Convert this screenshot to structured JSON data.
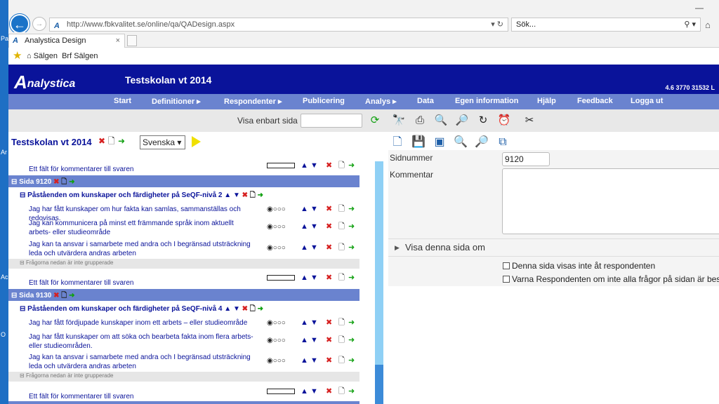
{
  "desktop": {
    "labels": [
      "Pa",
      "Ar",
      "Ac",
      "O"
    ]
  },
  "browser": {
    "url": "http://www.fbkvalitet.se/online/qa/QADesign.aspx",
    "search_placeholder": "Sök...",
    "tab_title": "Analystica Design",
    "favorites": [
      {
        "label": "Sälgen"
      },
      {
        "label": "Brf Sälgen"
      }
    ]
  },
  "app": {
    "logo": "nalystica",
    "logo_initial": "A",
    "title": "Testskolan vt 2014",
    "version": "4.6 3770 31532 L",
    "menu": [
      {
        "label": "Start"
      },
      {
        "label": "Definitioner"
      },
      {
        "label": "Respondenter"
      },
      {
        "label": "Publicering"
      },
      {
        "label": "Analys"
      },
      {
        "label": "Data"
      },
      {
        "label": "Egen information"
      },
      {
        "label": "Hjälp"
      },
      {
        "label": "Feedback"
      },
      {
        "label": "Logga ut"
      }
    ],
    "toolbar": {
      "filter_label": "Visa enbart sida",
      "filter_value": ""
    }
  },
  "survey": {
    "title": "Testskolan vt 2014",
    "language": "Svenska",
    "comment_label": "Ett fält för kommentarer till svaren",
    "ungrouped_label": "Frågorna nedan är inte grupperade",
    "pages": [
      {
        "label": "Sida 9120",
        "group": "Påståenden om kunskaper och färdigheter på SeQF-nivå 2",
        "questions": [
          "Jag har fått kunskaper om hur fakta kan samlas, sammanställas och redovisas.",
          "Jag kan kommunicera på minst ett främmande språk inom aktuellt arbets- eller studieområde",
          "Jag kan ta ansvar i samarbete med andra och I begränsad utsträckning leda och utvärdera andras arbeten"
        ]
      },
      {
        "label": "Sida 9130",
        "group": "Påståenden om kunskaper och färdigheter på SeQF-nivå 4",
        "questions": [
          "Jag har fått fördjupade kunskaper inom ett arbets – eller studieområde",
          "Jag har fått kunskaper om att söka och bearbeta fakta inom flera arbets- eller studieområden.",
          "Jag kan ta ansvar i samarbete med andra och I begränsad utsträckning leda och utvärdera andras arbeten"
        ]
      }
    ],
    "radio_glyphs": "◉○○○"
  },
  "detail": {
    "page_number_label": "Sidnummer",
    "page_number_value": "9120",
    "comment_label": "Kommentar",
    "visibility_section": "Visa denna sida om",
    "checkbox_hidden": "Denna sida visas inte åt respondenten",
    "checkbox_warn": "Varna Respondenten om inte alla frågor på sidan är bes"
  }
}
